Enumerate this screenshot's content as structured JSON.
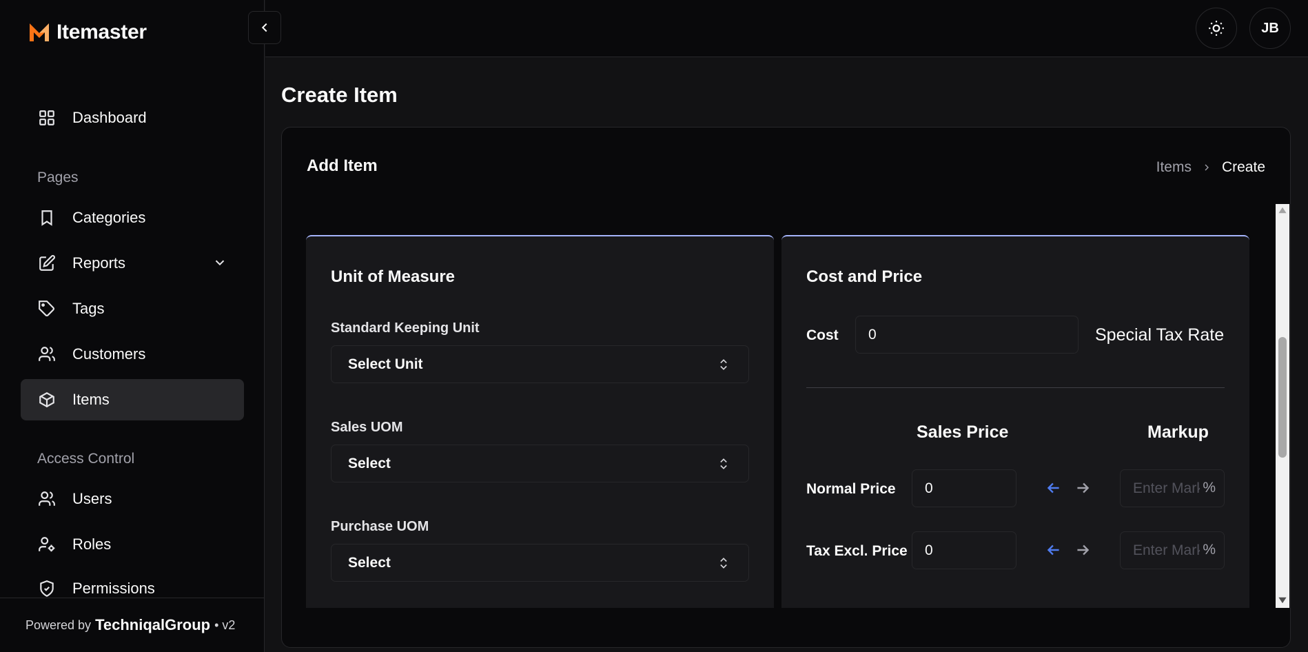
{
  "app": {
    "name": "Itemaster"
  },
  "header": {
    "avatar_initials": "JB",
    "theme_icon": "sun-icon"
  },
  "sidebar": {
    "dashboard": "Dashboard",
    "pages_label": "Pages",
    "categories": "Categories",
    "reports": "Reports",
    "tags": "Tags",
    "customers": "Customers",
    "items": "Items",
    "access_label": "Access Control",
    "users": "Users",
    "roles": "Roles",
    "permissions": "Permissions",
    "footer": {
      "prefix": "Powered by",
      "brand": "TechniqalGroup",
      "suffix": "• v2"
    }
  },
  "page": {
    "title": "Create Item",
    "card_title": "Add Item",
    "breadcrumb": {
      "link": "Items",
      "current": "Create"
    }
  },
  "uom": {
    "title": "Unit of Measure",
    "sku_label": "Standard Keeping Unit",
    "sku_value": "Select Unit",
    "sales_label": "Sales UOM",
    "sales_value": "Select",
    "purchase_label": "Purchase UOM",
    "purchase_value": "Select"
  },
  "cost_price": {
    "title": "Cost and Price",
    "cost_label": "Cost",
    "cost_value": "0",
    "tax_rate_label": "Special Tax Rate",
    "sales_price_head": "Sales Price",
    "markup_head": "Markup",
    "normal_label": "Normal Price",
    "normal_value": "0",
    "tax_excl_label": "Tax Excl. Price",
    "tax_excl_value": "0",
    "markup_placeholder": "Enter Markup",
    "percent": "%"
  },
  "colors": {
    "accent_blue": "#4f7cf0",
    "top_border": "#a5b4fc",
    "logo_orange": "#f97316"
  }
}
